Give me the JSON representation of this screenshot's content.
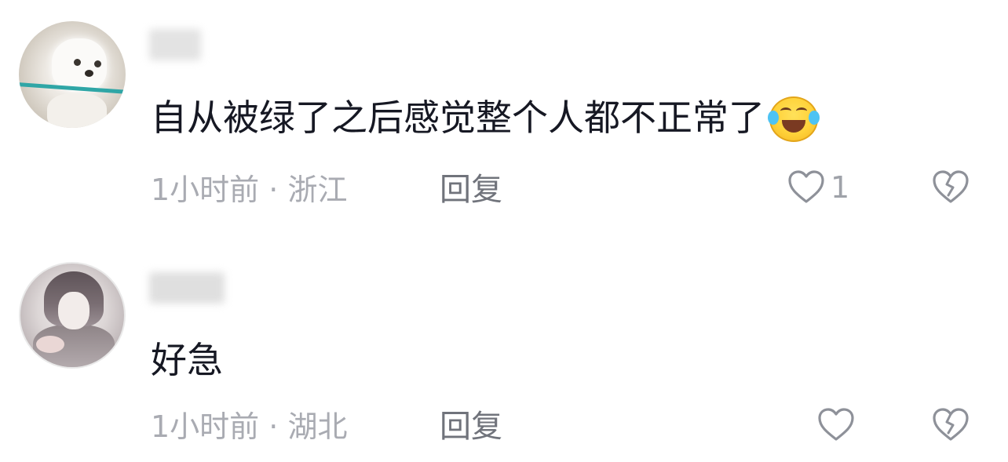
{
  "comments": [
    {
      "avatar": "dog-avatar",
      "username": "",
      "text": "自从被绿了之后感觉整个人都不正常了",
      "emoji": "laughing-crying-emoji",
      "time": "1小时前",
      "separator": "·",
      "location": "浙江",
      "reply_label": "回复",
      "like_count": "1",
      "like_icon": "heart-outline-icon",
      "dislike_icon": "broken-heart-icon"
    },
    {
      "avatar": "anime-avatar",
      "username": "",
      "text": "好急",
      "time": "1小时前",
      "separator": "·",
      "location": "湖北",
      "reply_label": "回复",
      "like_count": "",
      "like_icon": "heart-outline-icon",
      "dislike_icon": "broken-heart-icon"
    }
  ],
  "colors": {
    "text_primary": "#161823",
    "meta_text": "#a9abb2",
    "reply_text": "#70737b",
    "icon_stroke": "#8e9199"
  }
}
